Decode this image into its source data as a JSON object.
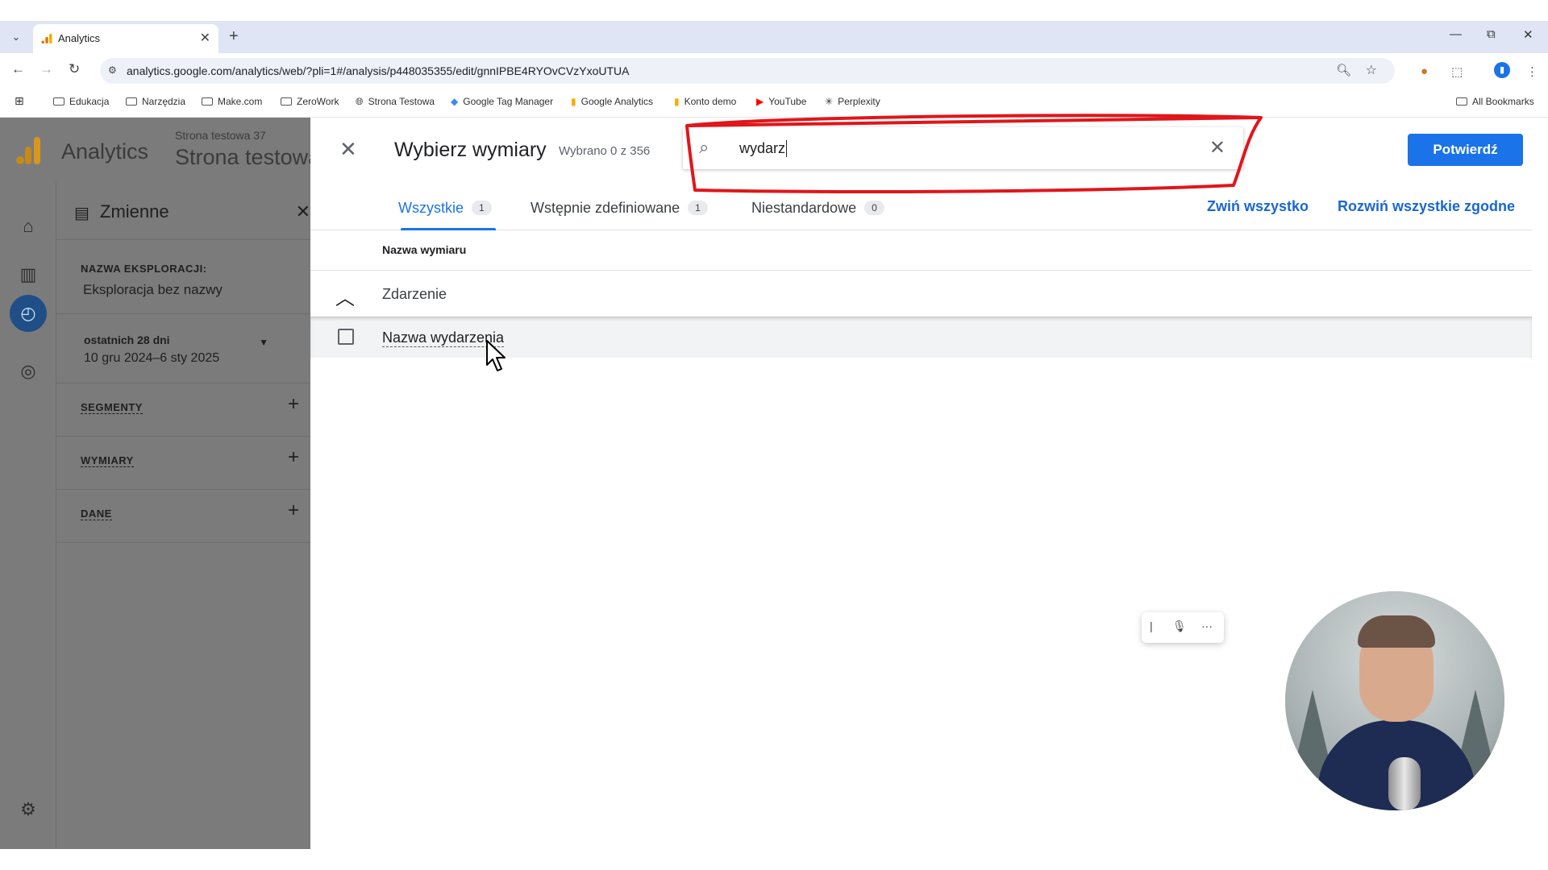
{
  "browser": {
    "tab_title": "Analytics",
    "url": "analytics.google.com/analytics/web/?pli=1#/analysis/p448035355/edit/gnnIPBE4RYOvCVzYxoUTUA",
    "bookmarks": [
      {
        "label": "Edukacja",
        "icon": "folder-icon"
      },
      {
        "label": "Narzędzia",
        "icon": "folder-icon"
      },
      {
        "label": "Make.com",
        "icon": "folder-icon"
      },
      {
        "label": "ZeroWork",
        "icon": "folder-icon"
      },
      {
        "label": "Strona Testowa",
        "icon": "globe-icon"
      },
      {
        "label": "Google Tag Manager",
        "icon": "gtm-icon"
      },
      {
        "label": "Google Analytics",
        "icon": "analytics-icon"
      },
      {
        "label": "Konto demo",
        "icon": "analytics-icon"
      },
      {
        "label": "YouTube",
        "icon": "youtube-icon"
      },
      {
        "label": "Perplexity",
        "icon": "perplexity-icon"
      }
    ],
    "all_bookmarks": "All Bookmarks"
  },
  "app": {
    "name": "Analytics",
    "property_small": "Strona testowa 37",
    "property_big": "Strona testowa"
  },
  "variables": {
    "title": "Zmienne",
    "exploration_label": "NAZWA EKSPLORACJI:",
    "exploration_value": "Eksploracja bez nazwy",
    "date_chip": "ostatnich 28 dni",
    "date_range": "10 gru 2024–6 sty 2025",
    "segments_label": "SEGMENTY",
    "dimensions_label": "WYMIARY",
    "metrics_label": "DANE"
  },
  "picker": {
    "title": "Wybierz wymiary",
    "selected_count": "Wybrano 0 z 356",
    "search_value": "wydarz",
    "confirm_label": "Potwierdź",
    "tabs": [
      {
        "label": "Wszystkie",
        "count": "1"
      },
      {
        "label": "Wstępnie zdefiniowane",
        "count": "1"
      },
      {
        "label": "Niestandardowe",
        "count": "0"
      }
    ],
    "collapse_all": "Zwiń wszystko",
    "expand_matching": "Rozwiń wszystkie zgodne",
    "column_header": "Nazwa wymiaru",
    "group_name": "Zdarzenie",
    "rows": [
      {
        "label": "Nazwa wydarzenia",
        "checked": false
      }
    ]
  },
  "colors": {
    "accent": "#1a73e8",
    "annotation": "#e0161b",
    "overlay": "#7b7b7b"
  }
}
